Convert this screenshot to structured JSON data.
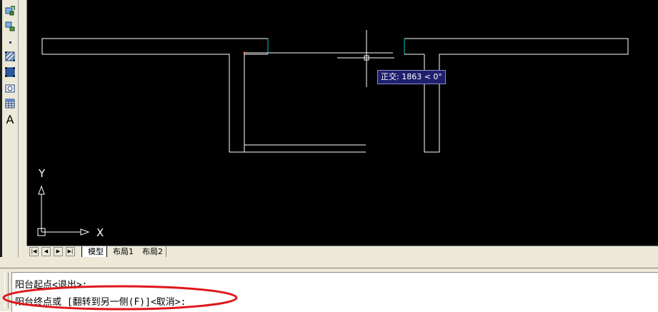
{
  "toolbar": {
    "tools": [
      {
        "icon": "rotate-object-icon"
      },
      {
        "icon": "move-object-icon"
      },
      {
        "icon": "point-icon"
      },
      {
        "icon": "hatch-icon"
      },
      {
        "icon": "region-icon"
      },
      {
        "icon": "block-icon"
      },
      {
        "icon": "table-icon"
      },
      {
        "icon": "text-icon",
        "glyph": "A"
      }
    ]
  },
  "canvas": {
    "background": "#000000",
    "line_color": "#ffffff",
    "highlight_color": "#00c8c8",
    "ucs": {
      "y_label": "Y",
      "x_label": "X"
    },
    "tooltip": "正交: 1863 < 0°"
  },
  "tabs": {
    "nav_buttons": [
      "|◀",
      "◀",
      "▶",
      "▶|"
    ],
    "items": [
      {
        "label": "模型",
        "active": true
      },
      {
        "label": "布局1",
        "active": false
      },
      {
        "label": "布局2",
        "active": false
      }
    ]
  },
  "command": {
    "line1": "阳台起点<退出>:",
    "line2": "阳台终点或 [翻转到另一侧(F)]<取消>:",
    "highlight_color": "#e0161d"
  }
}
